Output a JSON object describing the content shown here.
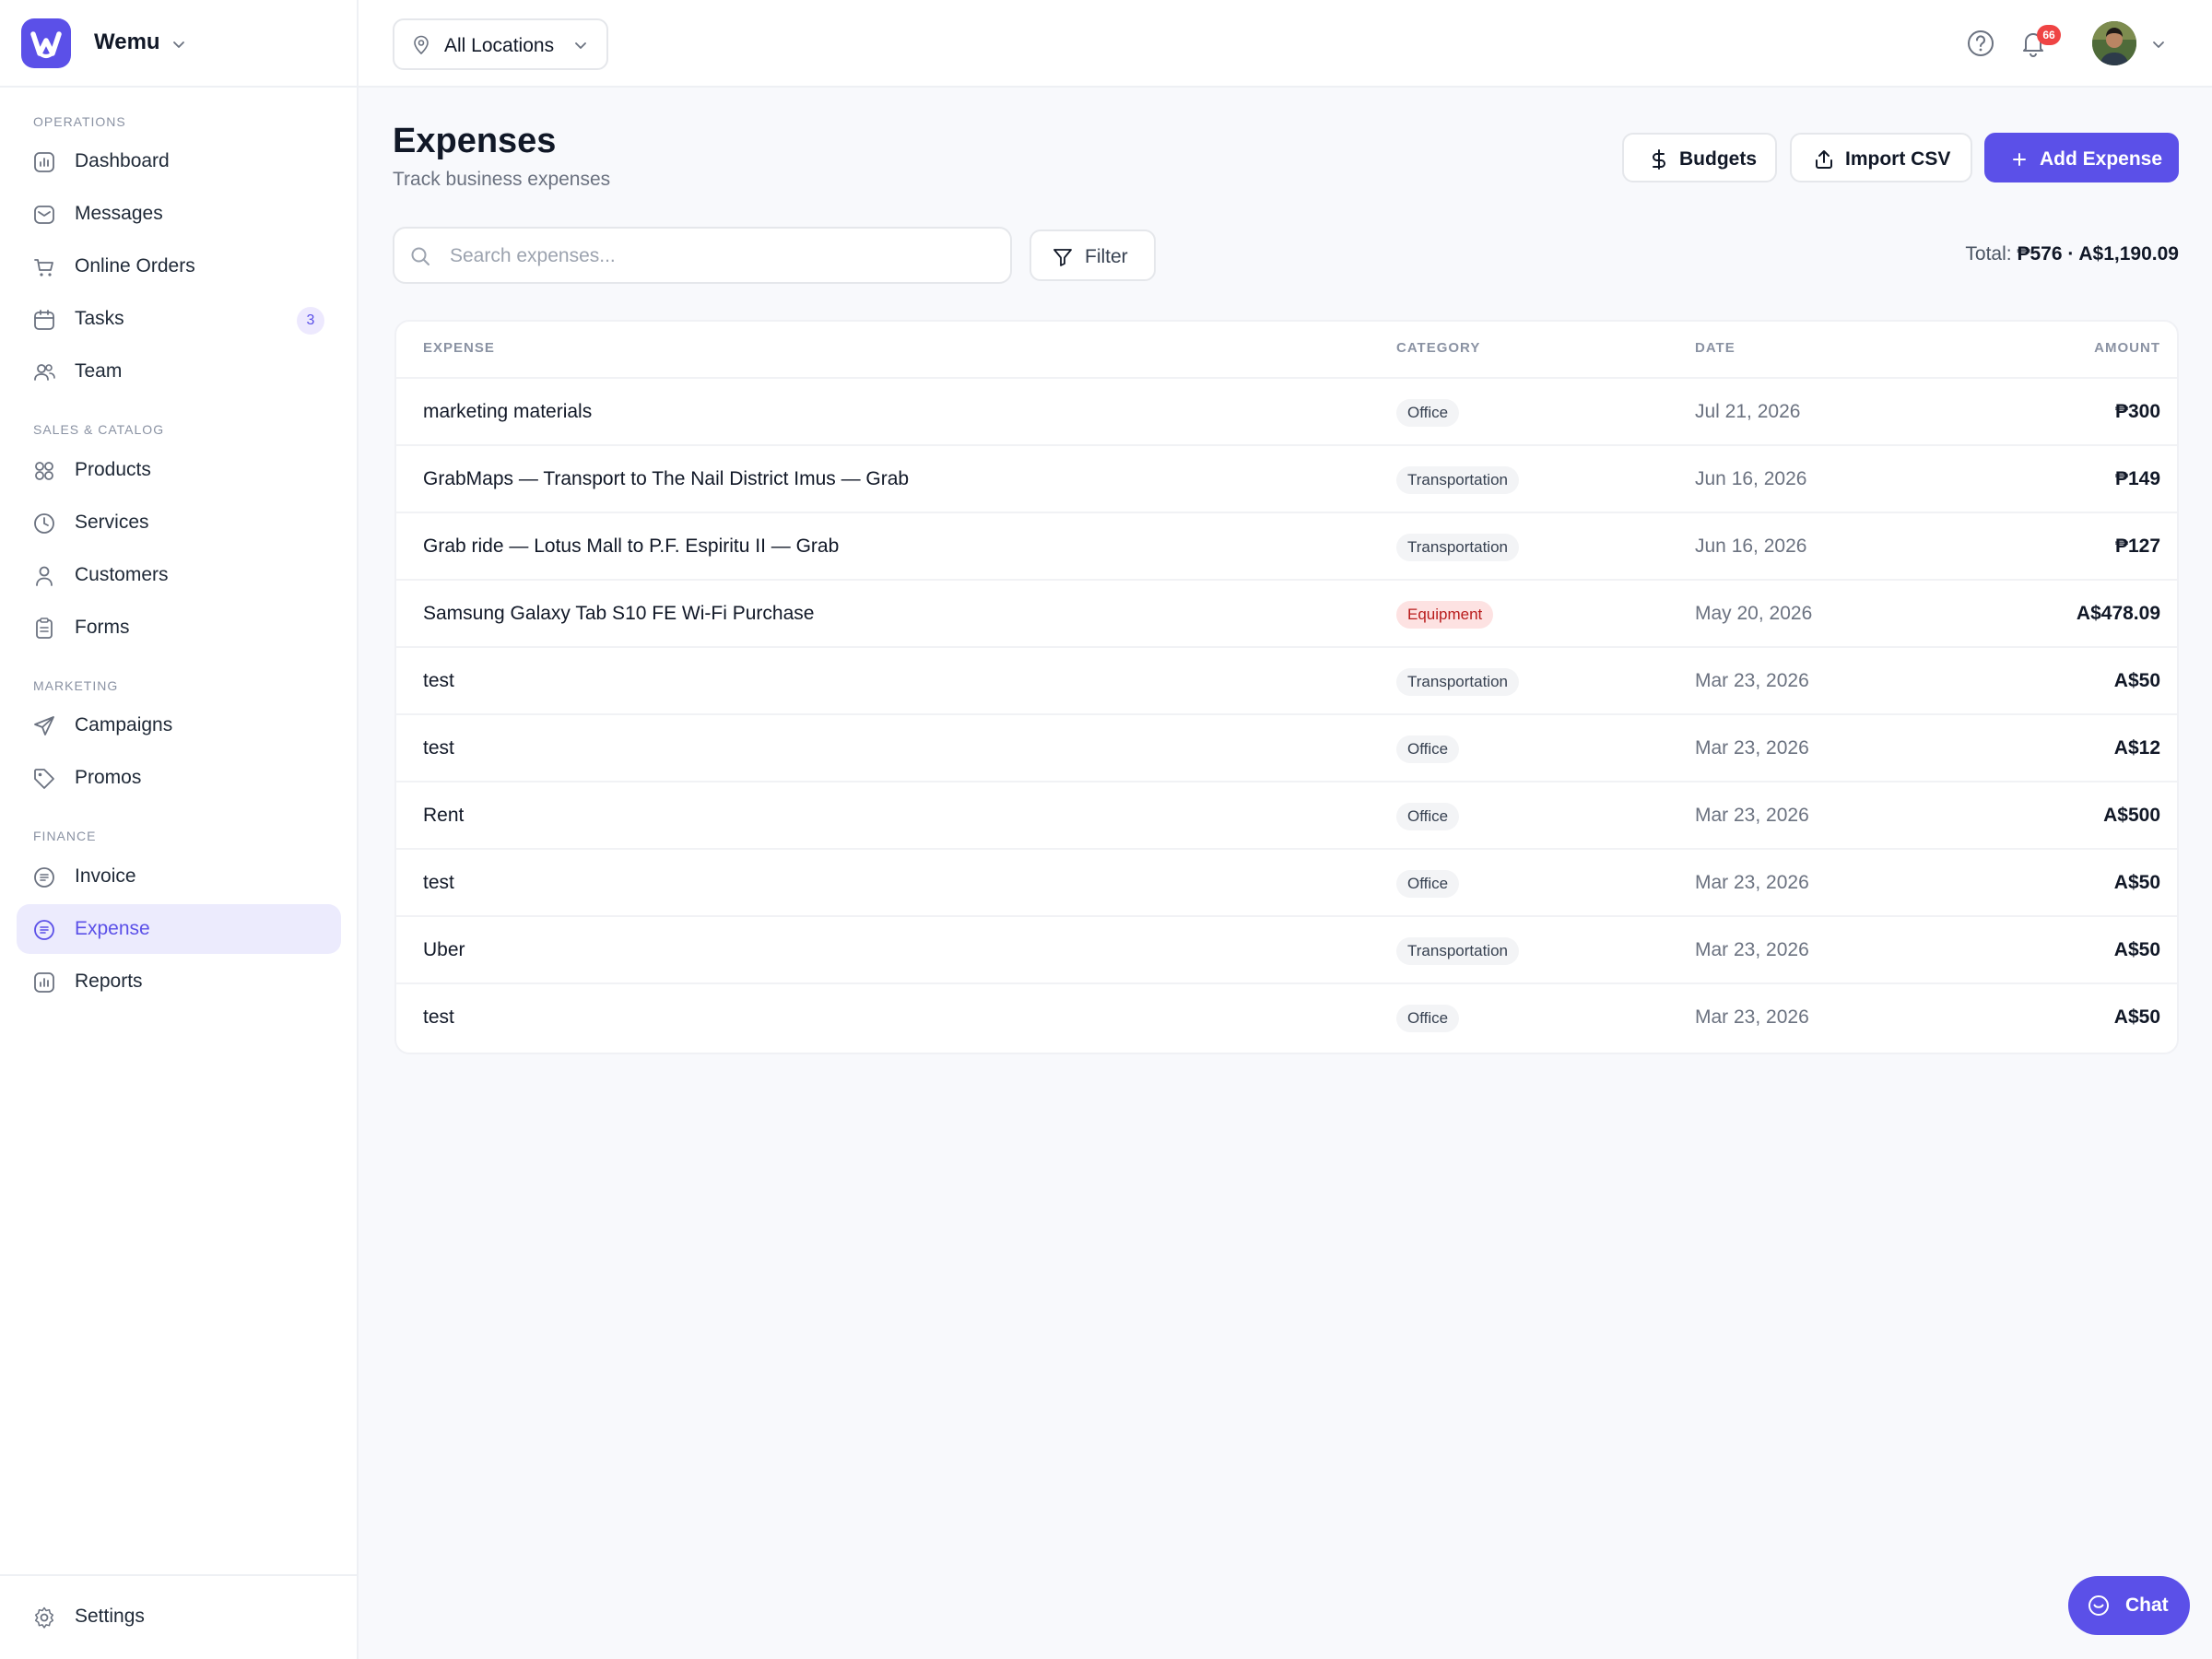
{
  "app": {
    "name": "Wemu"
  },
  "sidebar": {
    "sections": [
      {
        "title": "OPERATIONS"
      },
      {
        "title": "SALES & CATALOG"
      },
      {
        "title": "MARKETING"
      },
      {
        "title": "FINANCE"
      }
    ],
    "items": [
      {
        "label": "Dashboard",
        "icon": "dashboard-icon"
      },
      {
        "label": "Messages",
        "icon": "messages-icon"
      },
      {
        "label": "Online Orders",
        "icon": "cart-icon"
      },
      {
        "label": "Tasks",
        "icon": "calendar-icon",
        "badge": "3"
      },
      {
        "label": "Team",
        "icon": "team-icon"
      },
      {
        "label": "Products",
        "icon": "grid-icon"
      },
      {
        "label": "Services",
        "icon": "clock-icon"
      },
      {
        "label": "Customers",
        "icon": "user-icon"
      },
      {
        "label": "Forms",
        "icon": "clipboard-icon"
      },
      {
        "label": "Campaigns",
        "icon": "send-icon"
      },
      {
        "label": "Promos",
        "icon": "tag-icon"
      },
      {
        "label": "Invoice",
        "icon": "invoice-icon"
      },
      {
        "label": "Expense",
        "icon": "expense-icon",
        "active": true
      },
      {
        "label": "Reports",
        "icon": "reports-icon"
      }
    ],
    "settings_label": "Settings"
  },
  "topbar": {
    "location": "All Locations",
    "notification_count": "66"
  },
  "page": {
    "title": "Expenses",
    "subtitle": "Track business expenses",
    "buttons": {
      "budgets": "Budgets",
      "import_csv": "Import CSV",
      "add_expense": "Add Expense"
    },
    "search_placeholder": "Search expenses...",
    "filter_label": "Filter",
    "total_label": "Total:",
    "total_value": "₱576 · A$1,190.09"
  },
  "table": {
    "columns": [
      "EXPENSE",
      "CATEGORY",
      "DATE",
      "AMOUNT"
    ],
    "rows": [
      {
        "expense": "marketing materials",
        "category": "Office",
        "date": "Jul 21, 2026",
        "amount": "₱300"
      },
      {
        "expense": "GrabMaps — Transport to The Nail District Imus — Grab",
        "category": "Transportation",
        "date": "Jun 16, 2026",
        "amount": "₱149"
      },
      {
        "expense": "Grab ride — Lotus Mall to P.F. Espiritu II — Grab",
        "category": "Transportation",
        "date": "Jun 16, 2026",
        "amount": "₱127"
      },
      {
        "expense": "Samsung Galaxy Tab S10 FE Wi-Fi Purchase",
        "category": "Equipment",
        "date": "May 20, 2026",
        "amount": "A$478.09"
      },
      {
        "expense": "test",
        "category": "Transportation",
        "date": "Mar 23, 2026",
        "amount": "A$50"
      },
      {
        "expense": "test",
        "category": "Office",
        "date": "Mar 23, 2026",
        "amount": "A$12"
      },
      {
        "expense": "Rent",
        "category": "Office",
        "date": "Mar 23, 2026",
        "amount": "A$500"
      },
      {
        "expense": "test",
        "category": "Office",
        "date": "Mar 23, 2026",
        "amount": "A$50"
      },
      {
        "expense": "Uber",
        "category": "Transportation",
        "date": "Mar 23, 2026",
        "amount": "A$50"
      },
      {
        "expense": "test",
        "category": "Office",
        "date": "Mar 23, 2026",
        "amount": "A$50"
      }
    ]
  },
  "chat": {
    "label": "Chat"
  },
  "colors": {
    "accent": "#5b50e8",
    "danger": "#ef4444",
    "equipment_badge_bg": "#fde2e2",
    "equipment_badge_text": "#b91c1c"
  }
}
